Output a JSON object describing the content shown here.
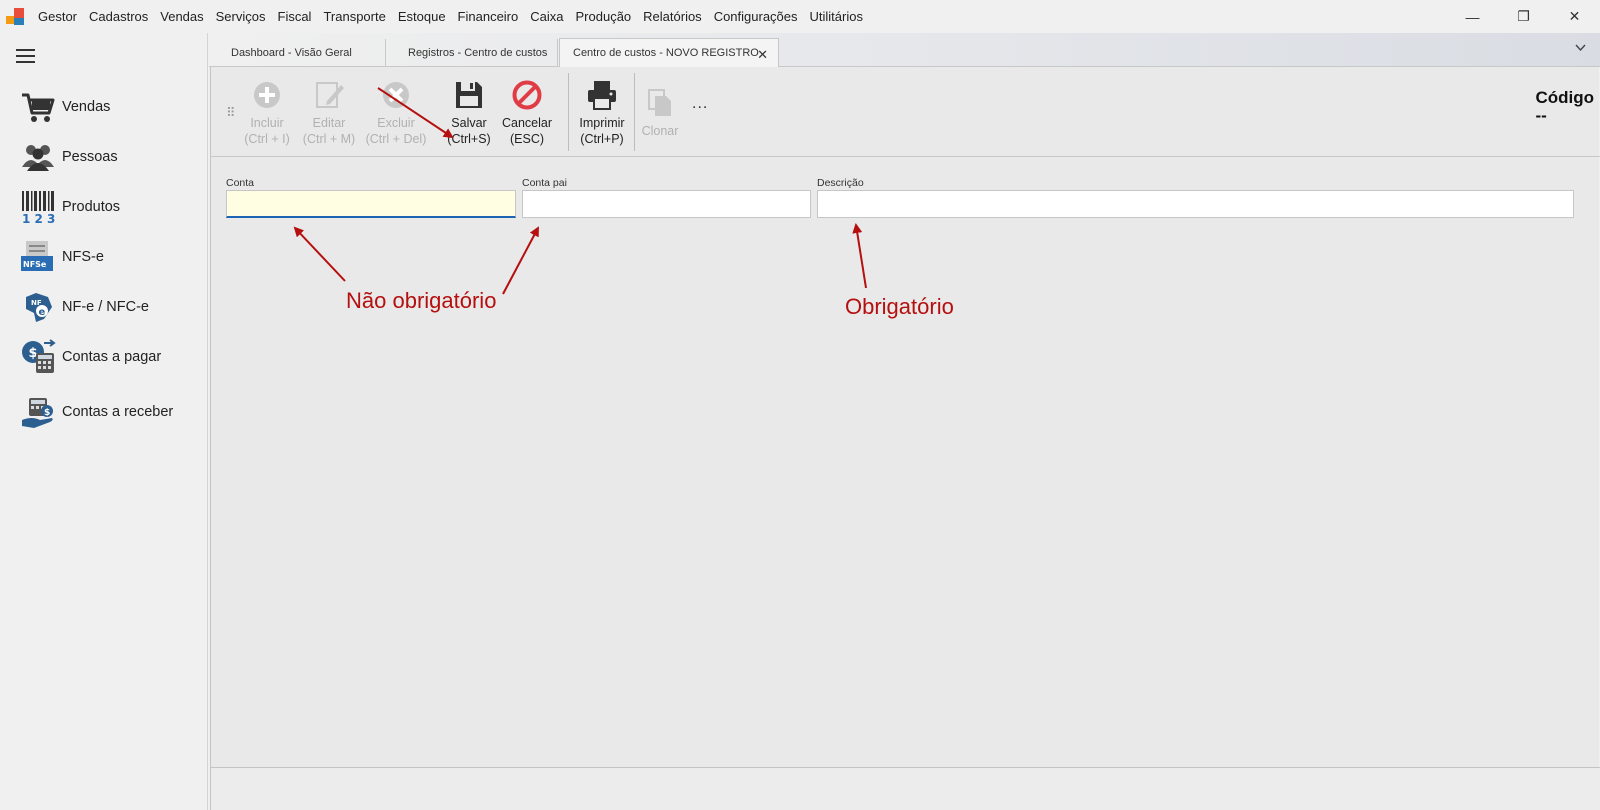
{
  "menu": {
    "items": [
      "Gestor",
      "Cadastros",
      "Vendas",
      "Serviços",
      "Fiscal",
      "Transporte",
      "Estoque",
      "Financeiro",
      "Caixa",
      "Produção",
      "Relatórios",
      "Configurações",
      "Utilitários"
    ]
  },
  "window_controls": {
    "minimize": "—",
    "restore": "❐",
    "close": "✕"
  },
  "sidebar": {
    "items": [
      {
        "label": "Vendas",
        "icon": "shopping-cart-icon"
      },
      {
        "label": "Pessoas",
        "icon": "people-icon"
      },
      {
        "label": "Produtos",
        "icon": "barcode-icon"
      },
      {
        "label": "NFS-e",
        "icon": "nfse-icon"
      },
      {
        "label": "NF-e / NFC-e",
        "icon": "nfe-icon"
      },
      {
        "label": "Contas a pagar",
        "icon": "payable-icon"
      },
      {
        "label": "Contas a receber",
        "icon": "receivable-icon"
      }
    ]
  },
  "tabs": [
    {
      "label": "Dashboard - Visão Geral",
      "active": false
    },
    {
      "label": "Registros - Centro de custos",
      "active": false
    },
    {
      "label": "Centro de custos - NOVO REGISTRO",
      "active": true
    }
  ],
  "toolbar": {
    "include": {
      "label": "Incluir",
      "shortcut": "(Ctrl + I)"
    },
    "edit": {
      "label": "Editar",
      "shortcut": "(Ctrl + M)"
    },
    "delete": {
      "label": "Excluir",
      "shortcut": "(Ctrl + Del)"
    },
    "save": {
      "label": "Salvar",
      "shortcut": "(Ctrl+S)"
    },
    "cancel": {
      "label": "Cancelar",
      "shortcut": "(ESC)"
    },
    "print": {
      "label": "Imprimir",
      "shortcut": "(Ctrl+P)"
    },
    "clone": {
      "label": "Clonar"
    },
    "more": "..."
  },
  "codigo": {
    "label": "Código",
    "value": "--"
  },
  "form": {
    "conta": {
      "label": "Conta",
      "value": ""
    },
    "conta_pai": {
      "label": "Conta pai",
      "value": ""
    },
    "descricao": {
      "label": "Descrição",
      "value": ""
    }
  },
  "annotations": {
    "optional": "Não obrigatório",
    "required": "Obrigatório"
  },
  "colors": {
    "annotation": "#b50f0f",
    "cancel_red": "#e03c45",
    "focus_blue": "#1e64b4",
    "icon_blue": "#2c5f8f"
  }
}
